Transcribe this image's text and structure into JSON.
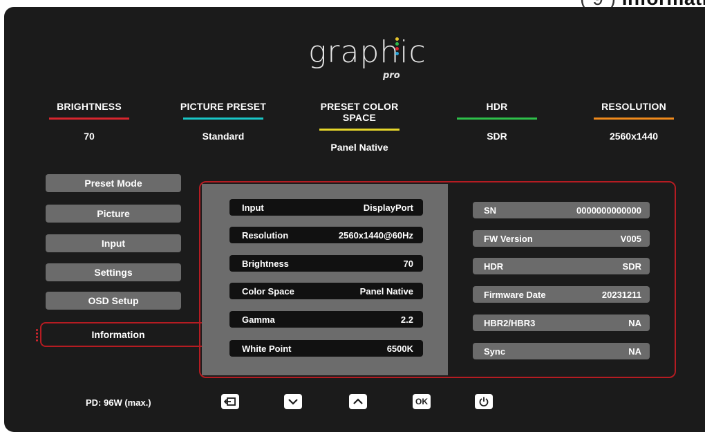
{
  "heading_fragment": {
    "paren": "( 9 )",
    "text": "Informati"
  },
  "logo": {
    "word": "graphic",
    "sub": "pro",
    "dot_colors": [
      "#e8c52c",
      "#2fb84c",
      "#d8262e",
      "#2aa4d8"
    ]
  },
  "status": [
    {
      "label": "BRIGHTNESS",
      "value": "70",
      "color": "#d8262e"
    },
    {
      "label": "PICTURE PRESET",
      "value": "Standard",
      "color": "#19c6c6"
    },
    {
      "label": "PRESET COLOR SPACE",
      "value": "Panel Native",
      "color": "#e6d72b"
    },
    {
      "label": "HDR",
      "value": "SDR",
      "color": "#2ec04a"
    },
    {
      "label": "RESOLUTION",
      "value": "2560x1440",
      "color": "#f08a1c"
    }
  ],
  "menu": {
    "items": [
      "Preset Mode",
      "Picture",
      "Input",
      "Settings",
      "OSD Setup"
    ],
    "selected": "Information"
  },
  "info_left": [
    {
      "label": "Input",
      "value": "DisplayPort"
    },
    {
      "label": "Resolution",
      "value": "2560x1440@60Hz"
    },
    {
      "label": "Brightness",
      "value": "70"
    },
    {
      "label": "Color Space",
      "value": "Panel Native"
    },
    {
      "label": "Gamma",
      "value": "2.2"
    },
    {
      "label": "White Point",
      "value": "6500K"
    }
  ],
  "info_right": [
    {
      "label": "SN",
      "value": "0000000000000"
    },
    {
      "label": "FW Version",
      "value": "V005"
    },
    {
      "label": "HDR",
      "value": "SDR"
    },
    {
      "label": "Firmware Date",
      "value": "20231211"
    },
    {
      "label": "HBR2/HBR3",
      "value": "NA"
    },
    {
      "label": "Sync",
      "value": "NA"
    }
  ],
  "footer": {
    "pd": "PD: 96W (max.)",
    "controls": [
      "exit-icon",
      "chevron-down-icon",
      "chevron-up-icon",
      "OK",
      "power-icon"
    ]
  },
  "colors": {
    "accent": "#b51c22",
    "background": "#1b1b1b",
    "panel_gray": "#6c6c6c",
    "button_gray": "#6b6b6b"
  }
}
